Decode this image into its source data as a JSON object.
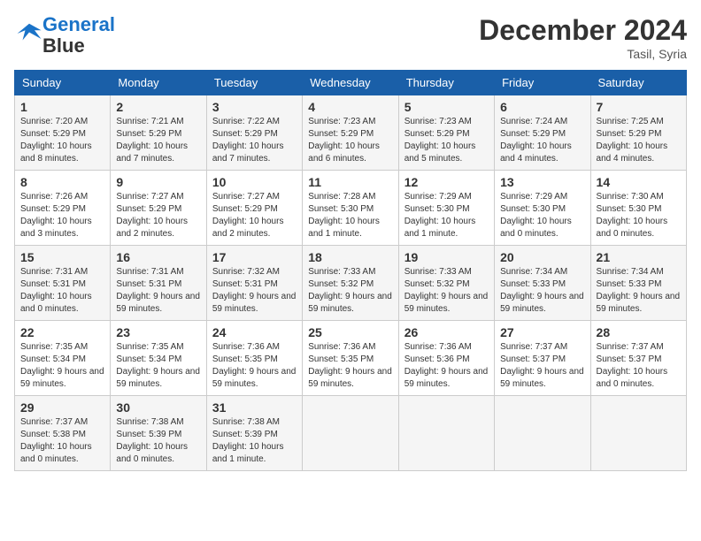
{
  "header": {
    "logo_line1": "General",
    "logo_line2": "Blue",
    "month": "December 2024",
    "location": "Tasil, Syria"
  },
  "weekdays": [
    "Sunday",
    "Monday",
    "Tuesday",
    "Wednesday",
    "Thursday",
    "Friday",
    "Saturday"
  ],
  "weeks": [
    [
      {
        "day": "1",
        "sunrise": "Sunrise: 7:20 AM",
        "sunset": "Sunset: 5:29 PM",
        "daylight": "Daylight: 10 hours and 8 minutes."
      },
      {
        "day": "2",
        "sunrise": "Sunrise: 7:21 AM",
        "sunset": "Sunset: 5:29 PM",
        "daylight": "Daylight: 10 hours and 7 minutes."
      },
      {
        "day": "3",
        "sunrise": "Sunrise: 7:22 AM",
        "sunset": "Sunset: 5:29 PM",
        "daylight": "Daylight: 10 hours and 7 minutes."
      },
      {
        "day": "4",
        "sunrise": "Sunrise: 7:23 AM",
        "sunset": "Sunset: 5:29 PM",
        "daylight": "Daylight: 10 hours and 6 minutes."
      },
      {
        "day": "5",
        "sunrise": "Sunrise: 7:23 AM",
        "sunset": "Sunset: 5:29 PM",
        "daylight": "Daylight: 10 hours and 5 minutes."
      },
      {
        "day": "6",
        "sunrise": "Sunrise: 7:24 AM",
        "sunset": "Sunset: 5:29 PM",
        "daylight": "Daylight: 10 hours and 4 minutes."
      },
      {
        "day": "7",
        "sunrise": "Sunrise: 7:25 AM",
        "sunset": "Sunset: 5:29 PM",
        "daylight": "Daylight: 10 hours and 4 minutes."
      }
    ],
    [
      {
        "day": "8",
        "sunrise": "Sunrise: 7:26 AM",
        "sunset": "Sunset: 5:29 PM",
        "daylight": "Daylight: 10 hours and 3 minutes."
      },
      {
        "day": "9",
        "sunrise": "Sunrise: 7:27 AM",
        "sunset": "Sunset: 5:29 PM",
        "daylight": "Daylight: 10 hours and 2 minutes."
      },
      {
        "day": "10",
        "sunrise": "Sunrise: 7:27 AM",
        "sunset": "Sunset: 5:29 PM",
        "daylight": "Daylight: 10 hours and 2 minutes."
      },
      {
        "day": "11",
        "sunrise": "Sunrise: 7:28 AM",
        "sunset": "Sunset: 5:30 PM",
        "daylight": "Daylight: 10 hours and 1 minute."
      },
      {
        "day": "12",
        "sunrise": "Sunrise: 7:29 AM",
        "sunset": "Sunset: 5:30 PM",
        "daylight": "Daylight: 10 hours and 1 minute."
      },
      {
        "day": "13",
        "sunrise": "Sunrise: 7:29 AM",
        "sunset": "Sunset: 5:30 PM",
        "daylight": "Daylight: 10 hours and 0 minutes."
      },
      {
        "day": "14",
        "sunrise": "Sunrise: 7:30 AM",
        "sunset": "Sunset: 5:30 PM",
        "daylight": "Daylight: 10 hours and 0 minutes."
      }
    ],
    [
      {
        "day": "15",
        "sunrise": "Sunrise: 7:31 AM",
        "sunset": "Sunset: 5:31 PM",
        "daylight": "Daylight: 10 hours and 0 minutes."
      },
      {
        "day": "16",
        "sunrise": "Sunrise: 7:31 AM",
        "sunset": "Sunset: 5:31 PM",
        "daylight": "Daylight: 9 hours and 59 minutes."
      },
      {
        "day": "17",
        "sunrise": "Sunrise: 7:32 AM",
        "sunset": "Sunset: 5:31 PM",
        "daylight": "Daylight: 9 hours and 59 minutes."
      },
      {
        "day": "18",
        "sunrise": "Sunrise: 7:33 AM",
        "sunset": "Sunset: 5:32 PM",
        "daylight": "Daylight: 9 hours and 59 minutes."
      },
      {
        "day": "19",
        "sunrise": "Sunrise: 7:33 AM",
        "sunset": "Sunset: 5:32 PM",
        "daylight": "Daylight: 9 hours and 59 minutes."
      },
      {
        "day": "20",
        "sunrise": "Sunrise: 7:34 AM",
        "sunset": "Sunset: 5:33 PM",
        "daylight": "Daylight: 9 hours and 59 minutes."
      },
      {
        "day": "21",
        "sunrise": "Sunrise: 7:34 AM",
        "sunset": "Sunset: 5:33 PM",
        "daylight": "Daylight: 9 hours and 59 minutes."
      }
    ],
    [
      {
        "day": "22",
        "sunrise": "Sunrise: 7:35 AM",
        "sunset": "Sunset: 5:34 PM",
        "daylight": "Daylight: 9 hours and 59 minutes."
      },
      {
        "day": "23",
        "sunrise": "Sunrise: 7:35 AM",
        "sunset": "Sunset: 5:34 PM",
        "daylight": "Daylight: 9 hours and 59 minutes."
      },
      {
        "day": "24",
        "sunrise": "Sunrise: 7:36 AM",
        "sunset": "Sunset: 5:35 PM",
        "daylight": "Daylight: 9 hours and 59 minutes."
      },
      {
        "day": "25",
        "sunrise": "Sunrise: 7:36 AM",
        "sunset": "Sunset: 5:35 PM",
        "daylight": "Daylight: 9 hours and 59 minutes."
      },
      {
        "day": "26",
        "sunrise": "Sunrise: 7:36 AM",
        "sunset": "Sunset: 5:36 PM",
        "daylight": "Daylight: 9 hours and 59 minutes."
      },
      {
        "day": "27",
        "sunrise": "Sunrise: 7:37 AM",
        "sunset": "Sunset: 5:37 PM",
        "daylight": "Daylight: 9 hours and 59 minutes."
      },
      {
        "day": "28",
        "sunrise": "Sunrise: 7:37 AM",
        "sunset": "Sunset: 5:37 PM",
        "daylight": "Daylight: 10 hours and 0 minutes."
      }
    ],
    [
      {
        "day": "29",
        "sunrise": "Sunrise: 7:37 AM",
        "sunset": "Sunset: 5:38 PM",
        "daylight": "Daylight: 10 hours and 0 minutes."
      },
      {
        "day": "30",
        "sunrise": "Sunrise: 7:38 AM",
        "sunset": "Sunset: 5:39 PM",
        "daylight": "Daylight: 10 hours and 0 minutes."
      },
      {
        "day": "31",
        "sunrise": "Sunrise: 7:38 AM",
        "sunset": "Sunset: 5:39 PM",
        "daylight": "Daylight: 10 hours and 1 minute."
      },
      null,
      null,
      null,
      null
    ]
  ]
}
